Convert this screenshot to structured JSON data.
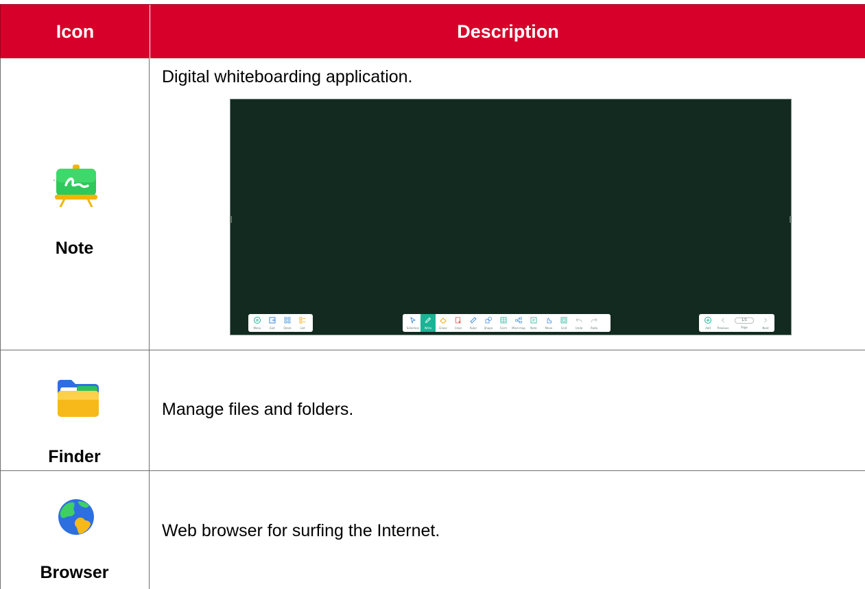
{
  "table": {
    "header": {
      "icon_col": "Icon",
      "desc_col": "Description"
    },
    "rows": [
      {
        "name": "Note",
        "description": "Digital whiteboarding application."
      },
      {
        "name": "Finder",
        "description": "Manage files and folders."
      },
      {
        "name": "Browser",
        "description": "Web browser for surfing the Internet."
      }
    ]
  },
  "colors": {
    "header_bg": "#d7002a",
    "board_bg": "#132a21",
    "tool_active": "#19b495"
  },
  "whiteboard": {
    "left_toolbar": [
      {
        "icon": "menu-icon",
        "label": "Menu"
      },
      {
        "icon": "exit-icon",
        "label": "Exit"
      },
      {
        "icon": "share-icon",
        "label": "Share"
      },
      {
        "icon": "list-icon",
        "label": "List"
      }
    ],
    "center_toolbar": [
      {
        "icon": "selection-icon",
        "label": "Selection"
      },
      {
        "icon": "write-icon",
        "label": "Write",
        "active": true
      },
      {
        "icon": "erase-icon",
        "label": "Erase"
      },
      {
        "icon": "clear-icon",
        "label": "Clear"
      },
      {
        "icon": "ruler-icon",
        "label": "Ruler"
      },
      {
        "icon": "shape-icon",
        "label": "Shape"
      },
      {
        "icon": "form-icon",
        "label": "Form"
      },
      {
        "icon": "mind-map-icon",
        "label": "Mind map"
      },
      {
        "icon": "note-icon",
        "label": "Note"
      },
      {
        "icon": "move-icon",
        "label": "Move"
      },
      {
        "icon": "grid-icon",
        "label": "Grid"
      },
      {
        "icon": "undo-icon",
        "label": "Undo"
      },
      {
        "icon": "redo-icon",
        "label": "Redo"
      }
    ],
    "right_toolbar": {
      "add_label": "Add",
      "previous_label": "Previous",
      "page_value": "1/1",
      "page_label": "Page",
      "next_label": "Next"
    }
  }
}
